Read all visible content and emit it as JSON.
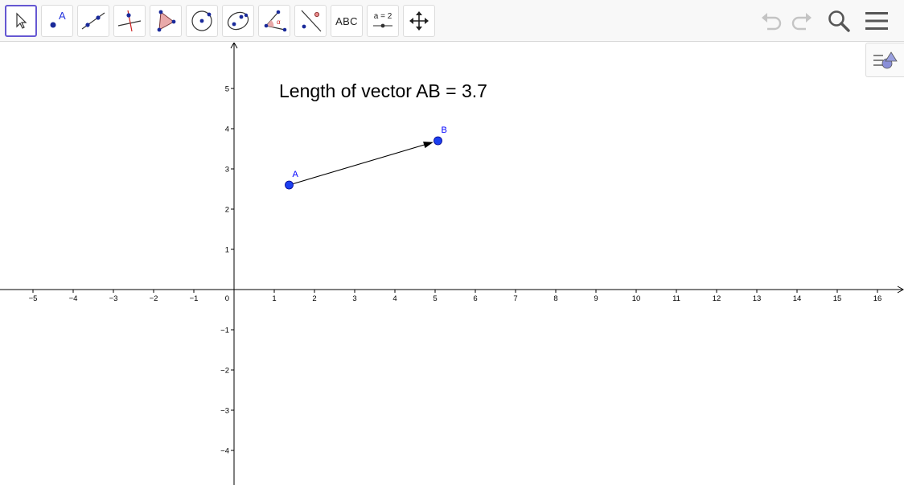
{
  "toolbar": {
    "tools": [
      {
        "name": "move-tool",
        "active": true
      },
      {
        "name": "point-tool",
        "label": "A"
      },
      {
        "name": "line-tool"
      },
      {
        "name": "perpendicular-line-tool"
      },
      {
        "name": "polygon-tool"
      },
      {
        "name": "circle-tool"
      },
      {
        "name": "ellipse-tool"
      },
      {
        "name": "angle-tool",
        "label": "α"
      },
      {
        "name": "reflect-tool"
      },
      {
        "name": "text-tool",
        "label": "ABC"
      },
      {
        "name": "slider-tool",
        "label": "a = 2"
      },
      {
        "name": "move-graphics-view-tool"
      }
    ],
    "undo_icon": "undo-icon",
    "redo_icon": "redo-icon",
    "search_icon": "search-icon",
    "menu_icon": "hamburger-menu-icon"
  },
  "style_bar_icon": "style-bar-toggle-icon",
  "graphics": {
    "text_label": "Length of vector AB = 3.7",
    "points": [
      {
        "label": "A",
        "x": 1.37,
        "y": 2.6
      },
      {
        "label": "B",
        "x": 5.07,
        "y": 3.7
      }
    ],
    "vector": {
      "from": "A",
      "to": "B"
    },
    "x_ticks": [
      "−5",
      "−4",
      "−3",
      "−2",
      "−1",
      "0",
      "1",
      "2",
      "3",
      "4",
      "5",
      "6",
      "7",
      "8",
      "9",
      "10",
      "11",
      "12",
      "13",
      "14",
      "15",
      "16"
    ],
    "y_ticks": [
      "5",
      "4",
      "3",
      "2",
      "1",
      "−1",
      "−2",
      "−3",
      "−4"
    ],
    "x_range": [
      -5.8,
      16.7
    ],
    "y_range": [
      -4.8,
      6.1
    ],
    "colors": {
      "point": "#0000ff",
      "point_fill": "#1b3ff0",
      "point_label": "#0000ff",
      "vector": "#000000",
      "axis": "#000000",
      "accent": "#6557d2"
    }
  }
}
